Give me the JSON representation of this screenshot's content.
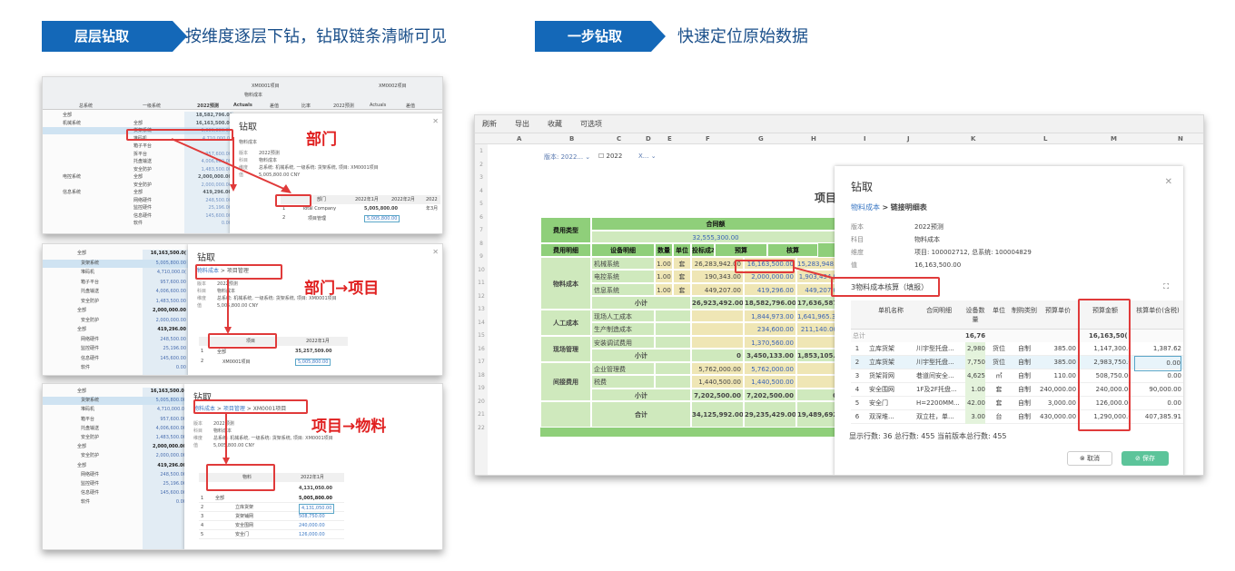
{
  "header": {
    "left_tag": "层层钻取",
    "left_desc": "按维度逐层下钻，钻取链条清晰可见",
    "right_tag": "一步钻取",
    "right_desc": "快速定位原始数据"
  },
  "colors": {
    "accent": "#1468b8",
    "highlight": "#e03a3a",
    "green": "#8fcf7a"
  },
  "panel1": {
    "top_headers": [
      "XM0001项目",
      "XM0002项目",
      "物料成本",
      "2022预测",
      "Actuals",
      "差值",
      "比率",
      "2022预测",
      "Actuals",
      "差值"
    ],
    "col_heads": [
      "总系统",
      "一级系统"
    ],
    "rows": [
      {
        "a": "全部",
        "b": "",
        "c": "18,582,796.0("
      },
      {
        "a": "机械系统",
        "b": "全部",
        "c": "16,163,500.0("
      },
      {
        "a": "",
        "b": "货架系统",
        "c": "5,005,800.00"
      },
      {
        "a": "",
        "b": "堆码机",
        "c": "4,710,000.0("
      },
      {
        "a": "",
        "b": "箱子平台",
        "c": ""
      },
      {
        "a": "",
        "b": "拆平台",
        "c": "957,600.00"
      },
      {
        "a": "",
        "b": "托盘输送",
        "c": "4,006,600.00"
      },
      {
        "a": "",
        "b": "安全防护",
        "c": "1,483,500.00"
      },
      {
        "a": "电控系统",
        "b": "全部",
        "c": "2,000,000.00"
      },
      {
        "a": "",
        "b": "安全防护",
        "c": "2,000,000.00"
      },
      {
        "a": "信息系统",
        "b": "全部",
        "c": "419,296.00"
      },
      {
        "a": "",
        "b": "网络硬件",
        "c": "248,500.00"
      },
      {
        "a": "",
        "b": "监控硬件",
        "c": "25,196.00"
      },
      {
        "a": "",
        "b": "信息硬件",
        "c": "145,600.00"
      },
      {
        "a": "",
        "b": "软件",
        "c": "0.00"
      }
    ],
    "dialog": {
      "title": "钻取",
      "crumb": "物料成本",
      "meta": [
        [
          "版本",
          "2022预测"
        ],
        [
          "科目",
          "物料成本"
        ],
        [
          "维度",
          "总系统: 机械系统, 一级系统: 货架系统, 项目: XM0001项目"
        ],
        [
          "值",
          "5,005,800.00 CNY"
        ]
      ],
      "table_head": [
        "部门",
        "2022年1月",
        "2022年2月",
        "2022年3月"
      ],
      "rows": [
        [
          "1",
          "Total Company",
          "5,005,800.00"
        ],
        [
          "2",
          "项目管理",
          "5,005,800.00"
        ]
      ]
    },
    "label": "部门"
  },
  "panel2": {
    "rows": [
      {
        "a": "全部",
        "c": "16,163,500.0("
      },
      {
        "a": "货架系统",
        "c": "5,005,800.00"
      },
      {
        "a": "堆码机",
        "c": "4,710,000.0("
      },
      {
        "a": "箱子平台",
        "c": "957,600.00"
      },
      {
        "a": "托盘输送",
        "c": "4,006,600.00"
      },
      {
        "a": "安全防护",
        "c": "1,483,500.00"
      },
      {
        "a": "全部",
        "c": "2,000,000.00"
      },
      {
        "a": "安全防护",
        "c": "2,000,000.00"
      },
      {
        "a": "全部",
        "c": "419,296.00"
      },
      {
        "a": "网络硬件",
        "c": "248,500.00"
      },
      {
        "a": "监控硬件",
        "c": "25,196.00"
      },
      {
        "a": "信息硬件",
        "c": "145,600.00"
      },
      {
        "a": "软件",
        "c": "0.00"
      }
    ],
    "dialog": {
      "title": "钻取",
      "crumb1": "物料成本",
      "crumb2": "项目管理",
      "meta": [
        [
          "版本",
          "2022预测"
        ],
        [
          "科目",
          "物料成本"
        ],
        [
          "维度",
          "总系统: 机械系统, 一级系统: 货架系统, 项目: XM0001项目"
        ],
        [
          "值",
          "5,005,800.00 CNY"
        ]
      ],
      "table_head": [
        "项目",
        "2022年1月"
      ],
      "rows": [
        [
          "1",
          "全部",
          "35,257,509.00"
        ],
        [
          "2",
          "XM0001项目",
          "5,005,800.00"
        ]
      ]
    },
    "label": "部门→项目"
  },
  "panel3": {
    "rows": [
      {
        "a": "全部",
        "c": "16,163,500.0("
      },
      {
        "a": "货架系统",
        "c": "5,005,800.00"
      },
      {
        "a": "堆码机",
        "c": "4,710,000.0("
      },
      {
        "a": "箱平台",
        "c": "957,600.00"
      },
      {
        "a": "托盘输送",
        "c": "4,006,600.00"
      },
      {
        "a": "安全防护",
        "c": "1,483,500.00"
      },
      {
        "a": "全部",
        "c": "2,000,000.00"
      },
      {
        "a": "安全防护",
        "c": "2,000,000.00"
      },
      {
        "a": "全部",
        "c": "419,296.00"
      },
      {
        "a": "网络硬件",
        "c": "248,500.00"
      },
      {
        "a": "监控硬件",
        "c": "25,196.00"
      },
      {
        "a": "信息硬件",
        "c": "145,600.00"
      },
      {
        "a": "软件",
        "c": "0.00"
      }
    ],
    "dialog": {
      "title": "钻取",
      "crumb1": "物料成本",
      "crumb2": "项目管理",
      "crumb3": "XM0001项目",
      "meta": [
        [
          "版本",
          "2022预测"
        ],
        [
          "科目",
          "物料成本"
        ],
        [
          "维度",
          "总系统: 机械系统, 一级系统: 货架系统, 项目: XM0001项目"
        ],
        [
          "值",
          "5,005,800.00 CNY"
        ]
      ],
      "table_head": [
        "物料",
        "2022年1月"
      ],
      "total": "4,131,050.00",
      "rows": [
        [
          "1",
          "全部",
          "5,005,800.00"
        ],
        [
          "2",
          "立库货架",
          "4,131,050.00"
        ],
        [
          "3",
          "货架铺网",
          "508,750.00"
        ],
        [
          "4",
          "安全围网",
          "240,000.00"
        ],
        [
          "5",
          "安全门",
          "126,000.00"
        ]
      ]
    },
    "label": "项目→物料"
  },
  "panel4": {
    "toolbar": [
      "刷新",
      "导出",
      "收藏",
      "可选项"
    ],
    "columns": [
      "A",
      "B",
      "C",
      "D",
      "E",
      "F",
      "G",
      "H",
      "I",
      "J",
      "K",
      "L",
      "M",
      "N"
    ],
    "filter_row": {
      "version": "版本: 2022...",
      "year": "2022",
      "x": "X..."
    },
    "title_fragment": "项目",
    "table": {
      "h1": [
        "费用类型",
        "合同额"
      ],
      "h1_value": "32,555,300.00",
      "h2": [
        "费用明细",
        "设备明细",
        "数量",
        "单位",
        "投标成本",
        "预算",
        "核算"
      ],
      "rows": [
        {
          "type": "物料成本",
          "dev": "机械系统",
          "qty": "1.00",
          "unit": "套",
          "bid": "26,283,942.00",
          "bud": "16,163,500.00",
          "act": "15,283,948.25"
        },
        {
          "type": "",
          "dev": "电控系统",
          "qty": "1.00",
          "unit": "套",
          "bid": "190,343.00",
          "bud": "2,000,000.00",
          "act": "1,903,494.0"
        },
        {
          "type": "",
          "dev": "信息系统",
          "qty": "1.00",
          "unit": "套",
          "bid": "449,207.00",
          "bud": "419,296.00",
          "act": "449,207.0"
        },
        {
          "type": "",
          "dev": "小计",
          "qty": "",
          "unit": "",
          "bid": "26,923,492.00",
          "bud": "18,582,796.00",
          "act": "17,636,587.24"
        },
        {
          "type": "人工成本",
          "dev": "现场人工成本",
          "qty": "",
          "unit": "",
          "bid": "",
          "bud": "1,844,973.00",
          "act": "1,641,965.30"
        },
        {
          "type": "",
          "dev": "生产制造成本",
          "qty": "",
          "unit": "",
          "bid": "",
          "bud": "234,600.00",
          "act": "211,140.00"
        },
        {
          "type": "现场管理",
          "dev": "安装调试费用",
          "qty": "",
          "unit": "",
          "bid": "",
          "bud": "1,370,560.00",
          "act": ""
        },
        {
          "type": "",
          "dev": "小计",
          "qty": "",
          "unit": "",
          "bid": "0",
          "bud": "3,450,133.00",
          "act": "1,853,105.30"
        },
        {
          "type": "间接费用",
          "dev": "企业管理费",
          "qty": "",
          "unit": "",
          "bid": "5,762,000.00",
          "bud": "5,762,000.00",
          "act": ""
        },
        {
          "type": "",
          "dev": "税费",
          "qty": "",
          "unit": "",
          "bid": "1,440,500.00",
          "bud": "1,440,500.00",
          "act": ""
        },
        {
          "type": "",
          "dev": "小计",
          "qty": "",
          "unit": "",
          "bid": "7,202,500.00",
          "bud": "7,202,500.00",
          "act": "0"
        },
        {
          "type": "",
          "dev": "合计",
          "qty": "",
          "unit": "",
          "bid": "34,125,992.00",
          "bud": "29,235,429.00",
          "act": "19,489,692.54"
        }
      ]
    },
    "dialog": {
      "title": "钻取",
      "crumb1": "物料成本",
      "crumb2": "链接明细表",
      "meta": [
        [
          "版本",
          "2022预测"
        ],
        [
          "科目",
          "物料成本"
        ],
        [
          "维度",
          "项目: 100002712, 总系统: 100004829"
        ],
        [
          "值",
          "16,163,500.00"
        ]
      ],
      "section": "3物料成本核算（填报）",
      "heads": [
        "单机名称",
        "合同明细",
        "设备数量",
        "单位",
        "制购类别",
        "预算单价",
        "预算金额",
        "核算单价(含税)"
      ],
      "total_row": {
        "label": "总计",
        "qty": "16,76",
        "amt": "16,163,50("
      },
      "rows": [
        [
          "1",
          "立库货架",
          "川宇型托盘...",
          "2,980",
          "货位",
          "自制",
          "385.00",
          "1,147,300.(",
          "1,387.62"
        ],
        [
          "2",
          "立库货架",
          "川宇型托盘...",
          "7,750",
          "货位",
          "自制",
          "385.00",
          "2,983,750.(",
          "0.00"
        ],
        [
          "3",
          "货架背网",
          "巷道间安全...",
          "4,625",
          "㎡",
          "自制",
          "110.00",
          "508,750.0(",
          "0.00"
        ],
        [
          "4",
          "安全围网",
          "1F及2F托盘...",
          "1.00",
          "套",
          "自制",
          "240,000.00",
          "240,000.0(",
          "90,000.00"
        ],
        [
          "5",
          "安全门",
          "H=2200MM...",
          "42.00",
          "套",
          "自制",
          "3,000.00",
          "126,000.0(",
          "0.00"
        ],
        [
          "6",
          "双深堆...",
          "双立柱，单...",
          "3.00",
          "台",
          "自制",
          "430,000.00",
          "1,290,000.(",
          "407,385.91"
        ]
      ],
      "footer": "显示行数: 36 总行数: 455 当前版本总行数: 455",
      "cancel": "取消",
      "save": "保存"
    }
  }
}
